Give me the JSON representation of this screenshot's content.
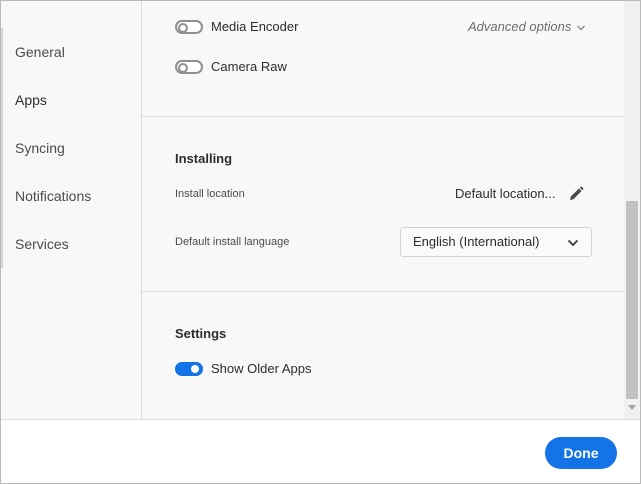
{
  "sidebar": {
    "items": [
      {
        "label": "General"
      },
      {
        "label": "Apps"
      },
      {
        "label": "Syncing"
      },
      {
        "label": "Notifications"
      },
      {
        "label": "Services"
      }
    ],
    "active": "Apps"
  },
  "apps": {
    "media_encoder": {
      "label": "Media Encoder",
      "enabled": false
    },
    "camera_raw": {
      "label": "Camera Raw",
      "enabled": false
    },
    "advanced_options": "Advanced options"
  },
  "installing": {
    "title": "Installing",
    "install_location_label": "Install location",
    "install_location_value": "Default location...",
    "language_label": "Default install language",
    "language_value": "English (International)"
  },
  "settings": {
    "title": "Settings",
    "show_older_apps": {
      "label": "Show Older Apps",
      "enabled": true
    }
  },
  "footer": {
    "done_label": "Done"
  },
  "colors": {
    "accent": "#1473e6",
    "sidebar_bg": "#f8f8f8",
    "divider": "#dadada"
  }
}
